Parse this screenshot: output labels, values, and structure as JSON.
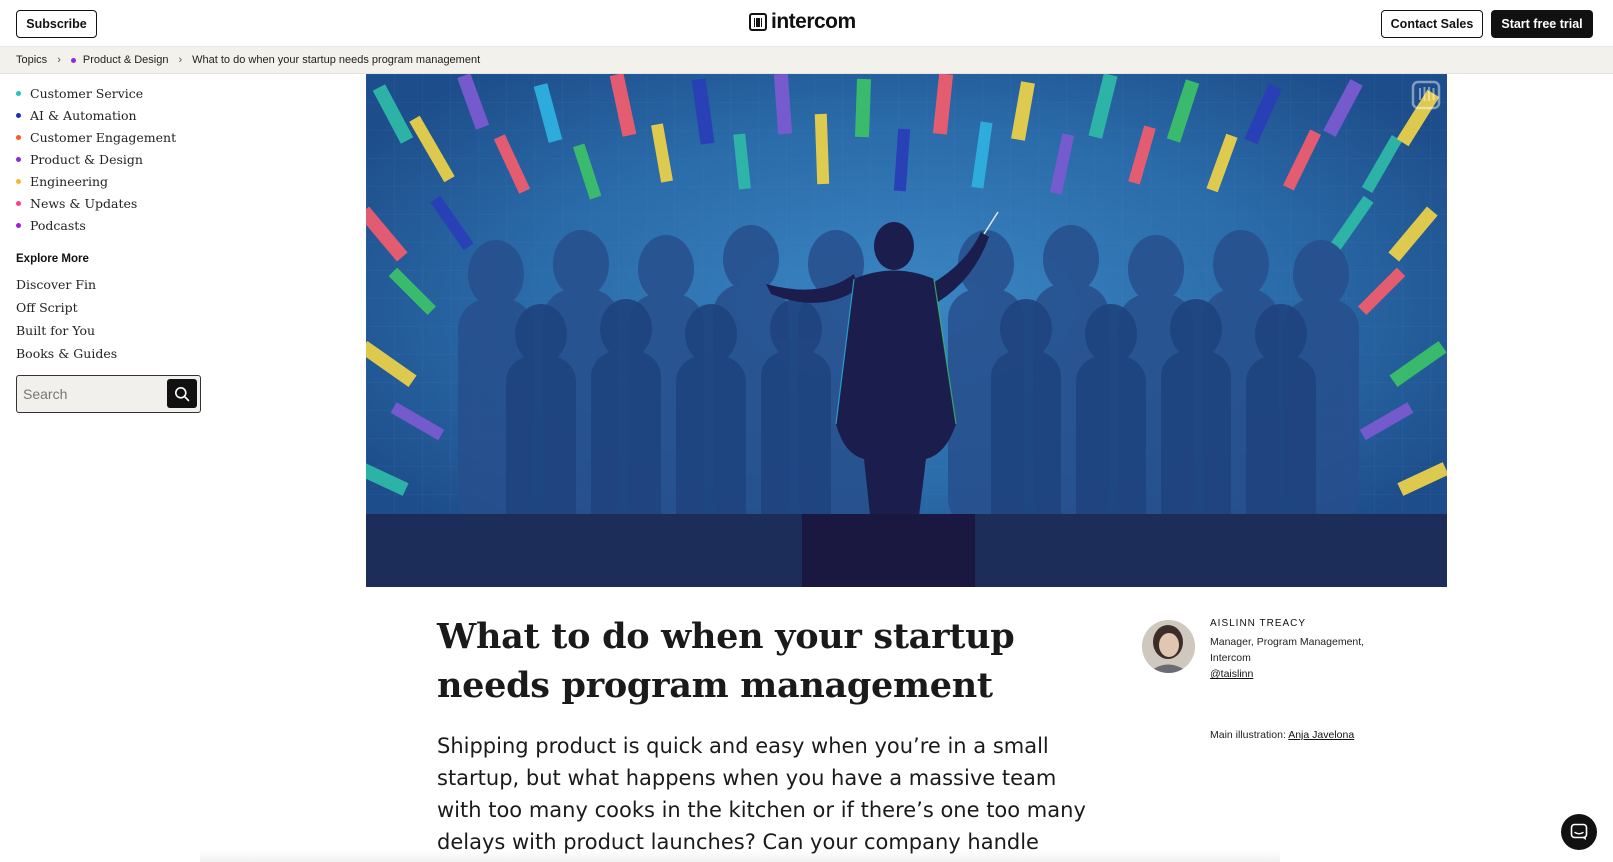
{
  "header": {
    "subscribe_label": "Subscribe",
    "logo_text": "intercom",
    "contact_sales_label": "Contact Sales",
    "start_trial_label": "Start free trial"
  },
  "breadcrumb": {
    "items": [
      {
        "label": "Topics"
      },
      {
        "label": "Product & Design",
        "dot_color": "#8a2be2"
      },
      {
        "label": "What to do when your startup needs program management"
      }
    ]
  },
  "sidebar": {
    "topics": [
      {
        "label": "Customer Service",
        "color": "#1ec9b4"
      },
      {
        "label": "AI & Automation",
        "color": "#1f2fb8"
      },
      {
        "label": "Customer Engagement",
        "color": "#ff5a1f"
      },
      {
        "label": "Product & Design",
        "color": "#8a2be2"
      },
      {
        "label": "Engineering",
        "color": "#f5b82e"
      },
      {
        "label": "News & Updates",
        "color": "#ff3d8b"
      },
      {
        "label": "Podcasts",
        "color": "#9b1fe0"
      }
    ],
    "explore_title": "Explore More",
    "explore_links": [
      "Discover Fin",
      "Off Script",
      "Built for You",
      "Books & Guides"
    ],
    "search_placeholder": "Search"
  },
  "article": {
    "title": "What to do when your startup needs program management",
    "lede": "Shipping product is quick and easy when you’re in a small startup, but what happens when you have a massive team with too many cooks in the kitchen or if there’s one too many delays with product launches? Can your company handle such",
    "author": {
      "name": "AISLINN TREACY",
      "role": "Manager, Program Management, Intercom",
      "handle": "@taislinn"
    },
    "illustration_credit_prefix": "Main illustration:",
    "illustration_credit_name": "Anja Javelona"
  },
  "icons": {
    "search": "search-icon",
    "chat": "chat-icon",
    "breadcrumb_separator": "chevron-right-icon"
  }
}
